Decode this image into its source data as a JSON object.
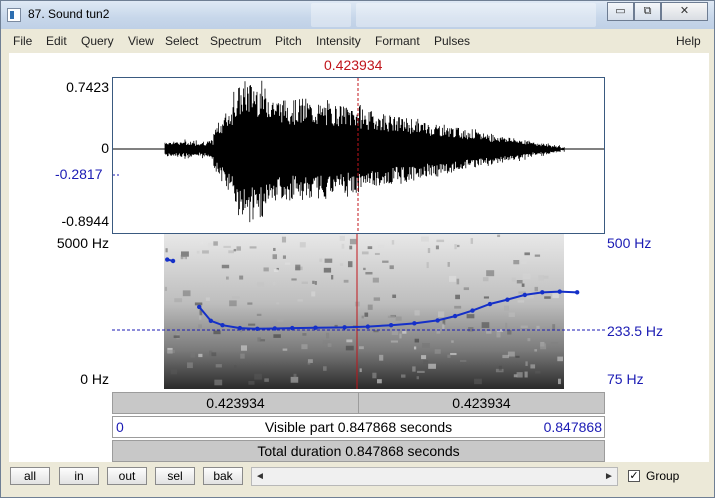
{
  "window": {
    "title": "87. Sound tun2",
    "minimize_label": "▭",
    "maximize_label": "⧉",
    "close_label": "✕"
  },
  "menu": [
    "File",
    "Edit",
    "Query",
    "View",
    "Select",
    "Spectrum",
    "Pitch",
    "Intensity",
    "Formant",
    "Pulses"
  ],
  "help_label": "Help",
  "cursor_time": "0.423934",
  "waveform": {
    "y_max": "0.7423",
    "y_zero": "0",
    "y_cursor": "-0.2817",
    "y_min": "-0.8944"
  },
  "spectrogram": {
    "freq_top": "5000 Hz",
    "freq_bottom": "0 Hz",
    "pitch_top": "500 Hz",
    "pitch_cursor": "233.5 Hz",
    "pitch_bottom": "75 Hz",
    "pitch_track": [
      [
        0.095,
        430
      ],
      [
        0.105,
        426
      ],
      [
        0.15,
        300
      ],
      [
        0.17,
        262
      ],
      [
        0.19,
        250
      ],
      [
        0.22,
        242
      ],
      [
        0.25,
        240
      ],
      [
        0.28,
        241
      ],
      [
        0.31,
        242
      ],
      [
        0.35,
        243
      ],
      [
        0.4,
        244
      ],
      [
        0.44,
        246
      ],
      [
        0.48,
        250
      ],
      [
        0.52,
        255
      ],
      [
        0.56,
        263
      ],
      [
        0.59,
        275
      ],
      [
        0.62,
        290
      ],
      [
        0.65,
        308
      ],
      [
        0.68,
        320
      ],
      [
        0.71,
        333
      ],
      [
        0.74,
        340
      ],
      [
        0.77,
        342
      ],
      [
        0.8,
        340
      ]
    ]
  },
  "bars": {
    "left_segment": "0.423934",
    "right_segment": "0.423934",
    "visible_start": "0",
    "visible_label": "Visible part 0.847868 seconds",
    "visible_end": "0.847868",
    "total_label": "Total duration 0.847868 seconds"
  },
  "toolbar": {
    "buttons": [
      "all",
      "in",
      "out",
      "sel",
      "bak"
    ],
    "scroll_left": "◄",
    "scroll_right": "►",
    "group_checked": "✓",
    "group_label": "Group"
  },
  "colors": {
    "cursor": "#c0151b",
    "pitch": "#1530c8",
    "axis_blue": "#1b1bb4"
  }
}
